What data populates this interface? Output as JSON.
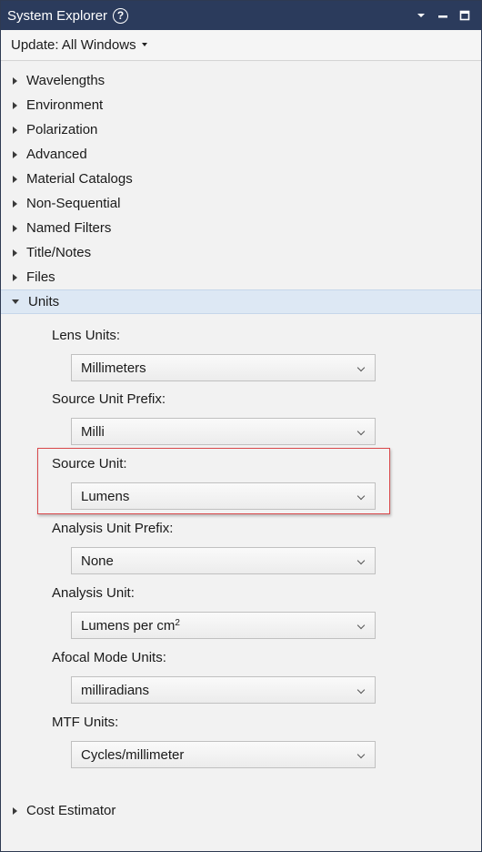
{
  "titlebar": {
    "title": "System Explorer",
    "help_glyph": "?",
    "help_icon": "help-circle-icon",
    "controls": [
      "dropdown-icon",
      "minimize-icon",
      "maximize-icon"
    ]
  },
  "update_bar": {
    "label": "Update: All Windows"
  },
  "tree": {
    "collapsed_items": [
      "Wavelengths",
      "Environment",
      "Polarization",
      "Advanced",
      "Material Catalogs",
      "Non-Sequential",
      "Named Filters",
      "Title/Notes",
      "Files"
    ],
    "expanded_item": "Units",
    "after_items": [
      "Cost Estimator"
    ]
  },
  "units": {
    "lens_units": {
      "label": "Lens Units:",
      "value": "Millimeters"
    },
    "source_unit_prefix": {
      "label": "Source Unit Prefix:",
      "value": "Milli"
    },
    "source_unit": {
      "label": "Source Unit:",
      "value": "Lumens"
    },
    "analysis_unit_prefix": {
      "label": "Analysis Unit Prefix:",
      "value": "None"
    },
    "analysis_unit": {
      "label": "Analysis Unit:",
      "value": "Lumens per cm",
      "value_sup": "2"
    },
    "afocal_mode_units": {
      "label": "Afocal Mode Units:",
      "value": "milliradians"
    },
    "mtf_units": {
      "label": "MTF Units:",
      "value": "Cycles/millimeter"
    }
  },
  "colors": {
    "titlebar_bg": "#2b3b5c",
    "selected_row_bg": "#dde8f4",
    "highlight_border": "#d9484b"
  }
}
